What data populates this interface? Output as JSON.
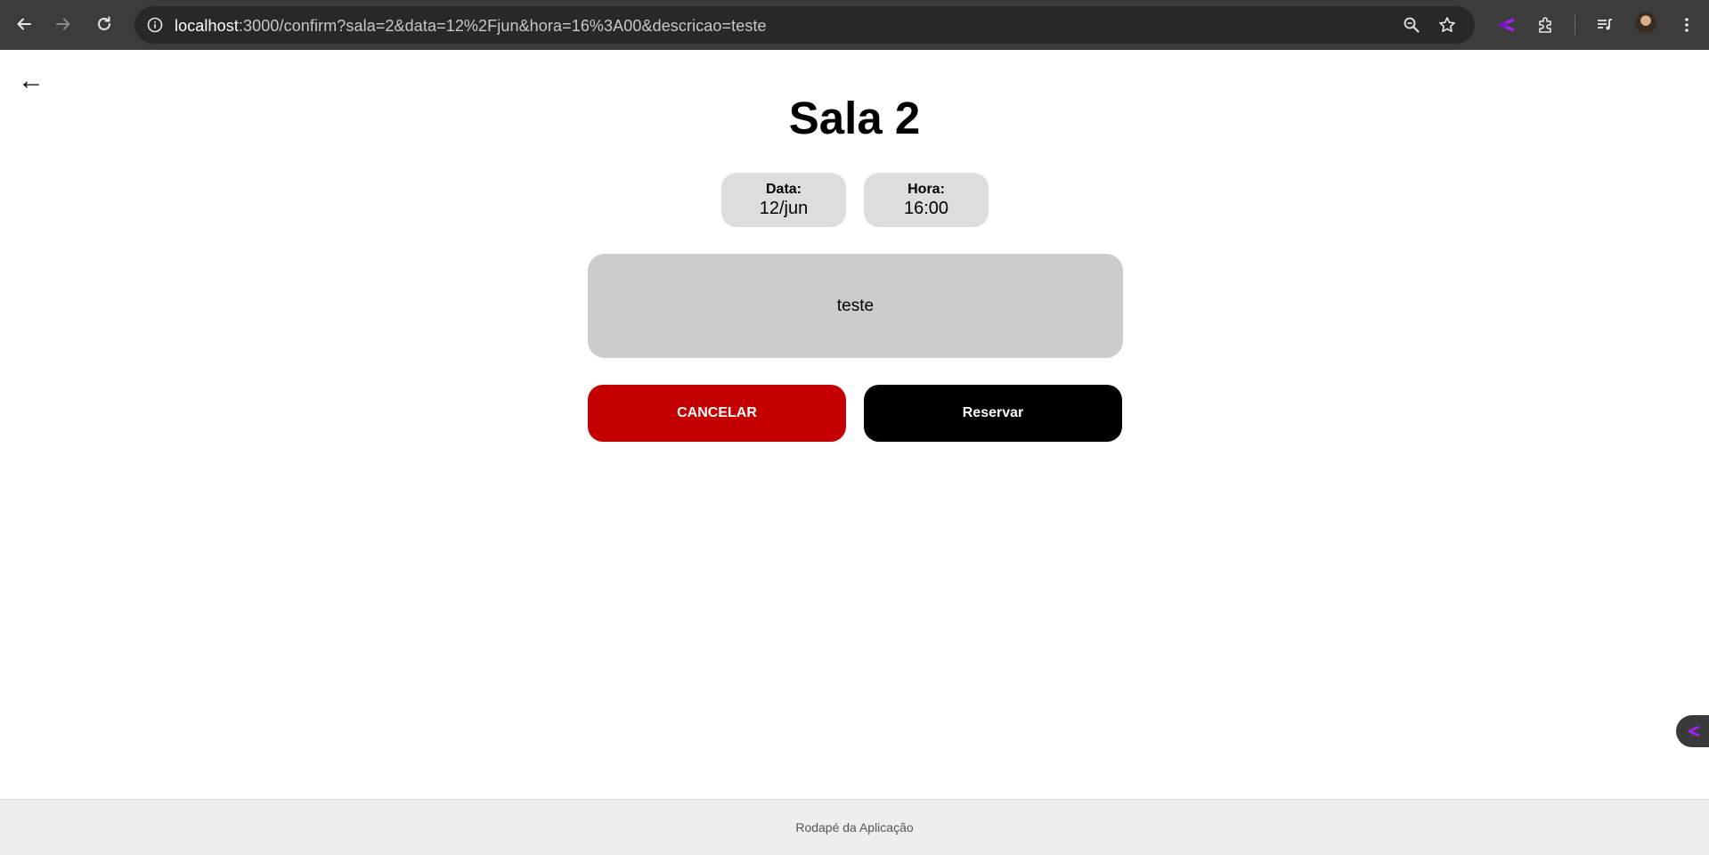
{
  "browser": {
    "url_host": "localhost",
    "url_rest": ":3000/confirm?sala=2&data=12%2Fjun&hora=16%3A00&descricao=teste",
    "icons": [
      "back-icon",
      "forward-icon",
      "reload-icon",
      "site-info-icon",
      "zoom-icon",
      "bookmark-star-icon",
      "extension-logo-icon",
      "extensions-puzzle-icon",
      "media-control-icon",
      "profile-avatar",
      "more-menu-icon"
    ],
    "accent_color": "#a020f0"
  },
  "page": {
    "back_symbol": "←",
    "title": "Sala 2",
    "data_label": "Data:",
    "data_value": "12/jun",
    "hora_label": "Hora:",
    "hora_value": "16:00",
    "descricao": "teste",
    "cancel_label": "CANCELAR",
    "reserve_label": "Reservar",
    "colors": {
      "cancel": "#c40000",
      "reserve": "#000000",
      "pill": "#dddddd",
      "desc": "#cccccc"
    }
  },
  "footer": {
    "text": "Rodapé da Aplicação"
  }
}
